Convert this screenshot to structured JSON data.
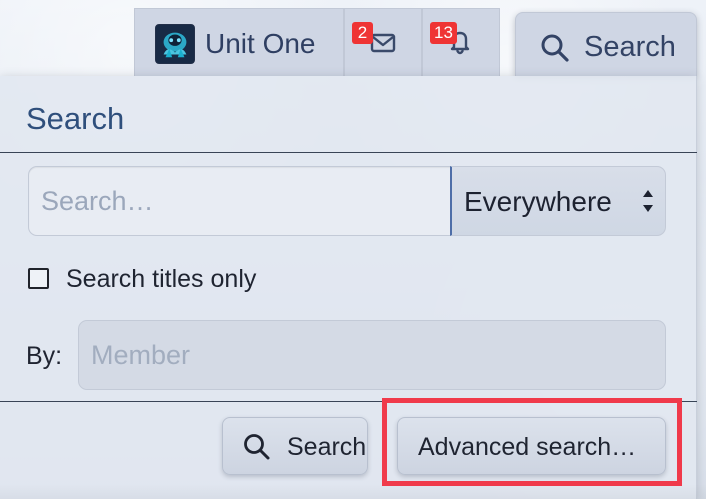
{
  "user_tab": {
    "name": "Unit One"
  },
  "conversations": {
    "badge_count": "2",
    "icon": "mail-icon"
  },
  "alerts": {
    "badge_count": "13",
    "icon": "bell-icon"
  },
  "top_search": {
    "label": "Search",
    "icon": "search-icon"
  },
  "panel": {
    "title": "Search",
    "keyword_placeholder": "Search…",
    "scope_selected": "Everywhere",
    "titles_only_label": "Search titles only",
    "titles_only_checked": false,
    "by_label": "By:",
    "member_placeholder": "Member"
  },
  "actions": {
    "search_label": "Search",
    "advanced_label": "Advanced search…"
  },
  "colors": {
    "accent": "#2f4f7c",
    "badge": "#ef3434",
    "highlight": "#f03a4b"
  }
}
